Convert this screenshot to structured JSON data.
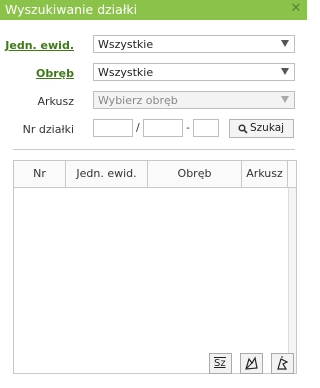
{
  "window": {
    "title": "Wyszukiwanie działki",
    "close_icon": "close-icon"
  },
  "form": {
    "jedn_label": "Jedn. ewid.",
    "jedn_value": "Wszystkie",
    "obreb_label": "Obręb",
    "obreb_value": "Wszystkie",
    "arkusz_label": "Arkusz",
    "arkusz_value": "Wybierz obręb",
    "nr_label": "Nr działki",
    "sep_slash": "/",
    "sep_dash": "-",
    "search_label": "Szukaj",
    "search_icon": "search-icon"
  },
  "table": {
    "columns": [
      "Nr",
      "Jedn. ewid.",
      "Obręb",
      "Arkusz"
    ],
    "rows": []
  },
  "footer": {
    "buttons": [
      "Sz",
      "edit-icon",
      "pointer-icon"
    ]
  },
  "colors": {
    "titlebar": "#8bc34a",
    "link": "#3e7a16"
  }
}
